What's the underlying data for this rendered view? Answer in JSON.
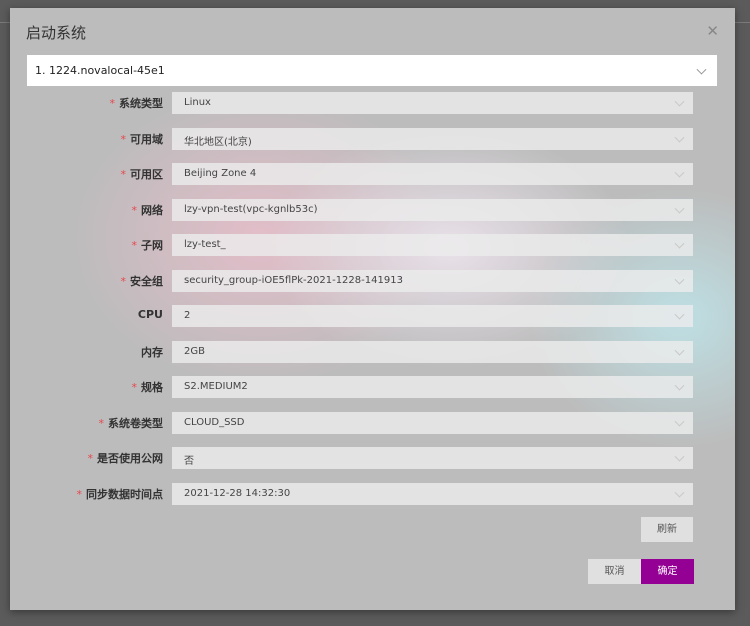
{
  "dialog": {
    "title": "启动系统",
    "instance_select": "1. 1224.novalocal-45e1",
    "fields": [
      {
        "label": "系统类型",
        "required": true,
        "value": "Linux"
      },
      {
        "label": "可用域",
        "required": true,
        "value": "华北地区(北京)"
      },
      {
        "label": "可用区",
        "required": true,
        "value": "Beijing Zone 4"
      },
      {
        "label": "网络",
        "required": true,
        "value": "lzy-vpn-test(vpc-kgnlb53c)"
      },
      {
        "label": "子网",
        "required": true,
        "value": "lzy-test_"
      },
      {
        "label": "安全组",
        "required": true,
        "value": "security_group-iOE5flPk-2021-1228-141913"
      },
      {
        "label": "CPU",
        "required": false,
        "value": "2"
      },
      {
        "label": "内存",
        "required": false,
        "value": "2GB"
      },
      {
        "label": "规格",
        "required": true,
        "value": "S2.MEDIUM2"
      },
      {
        "label": "系统卷类型",
        "required": true,
        "value": "CLOUD_SSD"
      },
      {
        "label": "是否使用公网",
        "required": true,
        "value": "否"
      },
      {
        "label": "同步数据时间点",
        "required": true,
        "value": "2021-12-28 14:32:30"
      }
    ],
    "refresh_label": "刷新",
    "cancel_label": "取消",
    "confirm_label": "确定",
    "required_mark": "*"
  },
  "colors": {
    "primary": "#940094",
    "required": "#e5484d"
  }
}
